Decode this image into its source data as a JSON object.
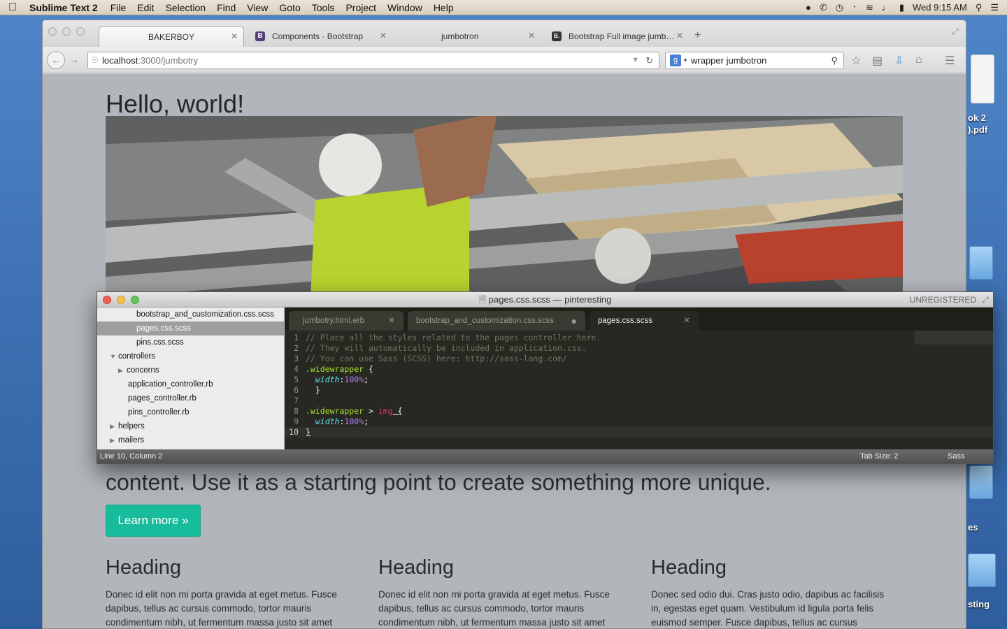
{
  "menubar": {
    "app_name": "Sublime Text 2",
    "items": [
      "File",
      "Edit",
      "Selection",
      "Find",
      "View",
      "Goto",
      "Tools",
      "Project",
      "Window",
      "Help"
    ],
    "clock": "Wed 9:15 AM"
  },
  "desktop": {
    "icon_label_1": "ok 2\n).pdf",
    "icon_label_2": "es",
    "icon_label_3": "sting"
  },
  "browser": {
    "tabs": [
      {
        "label": "BAKERBOY"
      },
      {
        "label": "Components · Bootstrap",
        "favicon": "B"
      },
      {
        "label": "jumbotron"
      },
      {
        "label": "Bootstrap Full image jumb…",
        "favicon": "B."
      }
    ],
    "url_host": "localhost",
    "url_path": ":3000/jumbotry",
    "search_value": "wrapper jumbotron",
    "search_engine": "g"
  },
  "page": {
    "title": "Hello, world!",
    "subtext": "content. Use it as a starting point to create something more unique.",
    "button_label": "Learn more »",
    "columns": [
      {
        "heading": "Heading",
        "body": "Donec id elit non mi porta gravida at eget metus. Fusce dapibus, tellus ac cursus commodo, tortor mauris condimentum nibh, ut fermentum massa justo sit amet"
      },
      {
        "heading": "Heading",
        "body": "Donec id elit non mi porta gravida at eget metus. Fusce dapibus, tellus ac cursus commodo, tortor mauris condimentum nibh, ut fermentum massa justo sit amet"
      },
      {
        "heading": "Heading",
        "body": "Donec sed odio dui. Cras justo odio, dapibus ac facilisis in, egestas eget quam. Vestibulum id ligula porta felis euismod semper. Fusce dapibus, tellus ac cursus commodo, tortor"
      }
    ]
  },
  "sublime": {
    "window_title": "pages.css.scss — pinteresting",
    "unregistered": "UNREGISTERED",
    "sidebar": [
      {
        "label": "bootstrap_and_customization.css.scss"
      },
      {
        "label": "pages.css.scss"
      },
      {
        "label": "pins.css.scss"
      },
      {
        "label": "controllers"
      },
      {
        "label": "concerns"
      },
      {
        "label": "application_controller.rb"
      },
      {
        "label": "pages_controller.rb"
      },
      {
        "label": "pins_controller.rb"
      },
      {
        "label": "helpers"
      },
      {
        "label": "mailers"
      }
    ],
    "tabs": [
      {
        "label": "jumbotry.html.erb"
      },
      {
        "label": "bootstrap_and_customization.css.scss"
      },
      {
        "label": "pages.css.scss"
      }
    ],
    "code": {
      "l1": "// Place all the styles related to the pages controller here.",
      "l2": "// They will automatically be included in application.css.",
      "l3": "// You can use Sass (SCSS) here: http://sass-lang.com/",
      "l4_sel": ".widewrapper",
      "l4_rest": " {",
      "l5_prop": "width",
      "l5_val": "100%",
      "l6": "}",
      "l8_sel": ".widewrapper",
      "l8_op": " > ",
      "l8_tag": "img",
      "l8_rest": " {",
      "l9_prop": "width",
      "l9_val": "100%",
      "l10": "}"
    },
    "status_left": "Line 10, Column 2",
    "status_tab": "Tab Size: 2",
    "status_syntax": "Sass"
  }
}
